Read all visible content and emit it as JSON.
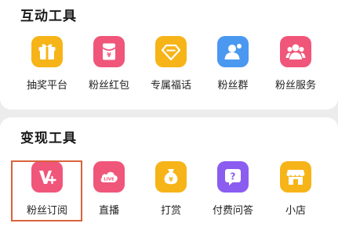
{
  "interactive_tools": {
    "title": "互动工具",
    "items": [
      {
        "label": "抽奖平台",
        "icon": "gift-icon",
        "color": "#f6b418"
      },
      {
        "label": "粉丝红包",
        "icon": "red-packet-icon",
        "color": "#f0567a"
      },
      {
        "label": "专属福话",
        "icon": "diamond-icon",
        "color": "#f6b418"
      },
      {
        "label": "粉丝群",
        "icon": "group-chat-icon",
        "color": "#4a98f0"
      },
      {
        "label": "粉丝服务",
        "icon": "fans-service-icon",
        "color": "#f0567a"
      }
    ]
  },
  "monetization_tools": {
    "title": "变现工具",
    "items": [
      {
        "label": "粉丝订阅",
        "icon": "subscription-v-plus-icon",
        "color": "#f0567a"
      },
      {
        "label": "直播",
        "icon": "live-cloud-icon",
        "color": "#f0567a"
      },
      {
        "label": "打赏",
        "icon": "money-bag-icon",
        "color": "#f6b418"
      },
      {
        "label": "付费问答",
        "icon": "question-icon",
        "color": "#8b5cf0"
      },
      {
        "label": "小店",
        "icon": "shop-icon",
        "color": "#f6b418"
      }
    ]
  },
  "highlight_color": "#d9623b"
}
